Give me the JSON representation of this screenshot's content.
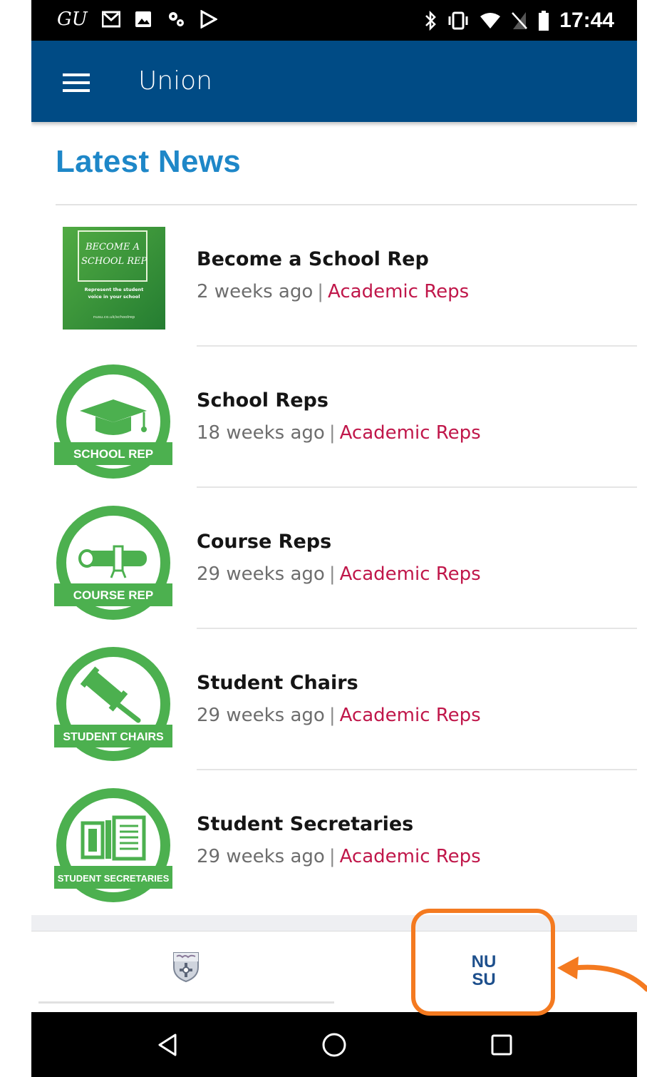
{
  "status_bar": {
    "left_text": "GU",
    "time": "17:44"
  },
  "app_bar": {
    "title": "Union"
  },
  "section": {
    "title": "Latest News"
  },
  "news": [
    {
      "title": "Become a School Rep",
      "age": "2 weeks ago",
      "separator": "|",
      "category": "Academic Reps",
      "thumb": "become-school-rep-poster"
    },
    {
      "title": "School Reps",
      "age": "18 weeks ago",
      "separator": "|",
      "category": "Academic Reps",
      "thumb": "school-rep-badge",
      "badge_label": "SCHOOL REP"
    },
    {
      "title": "Course Reps",
      "age": "29 weeks ago",
      "separator": "|",
      "category": "Academic Reps",
      "thumb": "course-rep-badge",
      "badge_label": "COURSE REP"
    },
    {
      "title": "Student Chairs",
      "age": "29 weeks ago",
      "separator": "|",
      "category": "Academic Reps",
      "thumb": "student-chairs-badge",
      "badge_label": "STUDENT CHAIRS"
    },
    {
      "title": "Student Secretaries",
      "age": "29 weeks ago",
      "separator": "|",
      "category": "Academic Reps",
      "thumb": "student-secretaries-badge",
      "badge_label": "STUDENT SECRETARIES"
    }
  ],
  "poster": {
    "line1": "BECOME A",
    "line2": "SCHOOL REP",
    "line3": "Represent the student",
    "line4": "voice in your school",
    "line5": "nusu.co.uk/schoolrep"
  },
  "bottom_nav": {
    "tabs": [
      {
        "icon": "university-crest-icon"
      },
      {
        "icon": "nusu-logo-icon",
        "logo_line1": "NU",
        "logo_line2": "SU"
      }
    ]
  },
  "colors": {
    "app_bar": "#004b85",
    "heading": "#1e87c8",
    "category": "#c0174a",
    "badge_green": "#4cb04f",
    "highlight": "#f47a20"
  }
}
